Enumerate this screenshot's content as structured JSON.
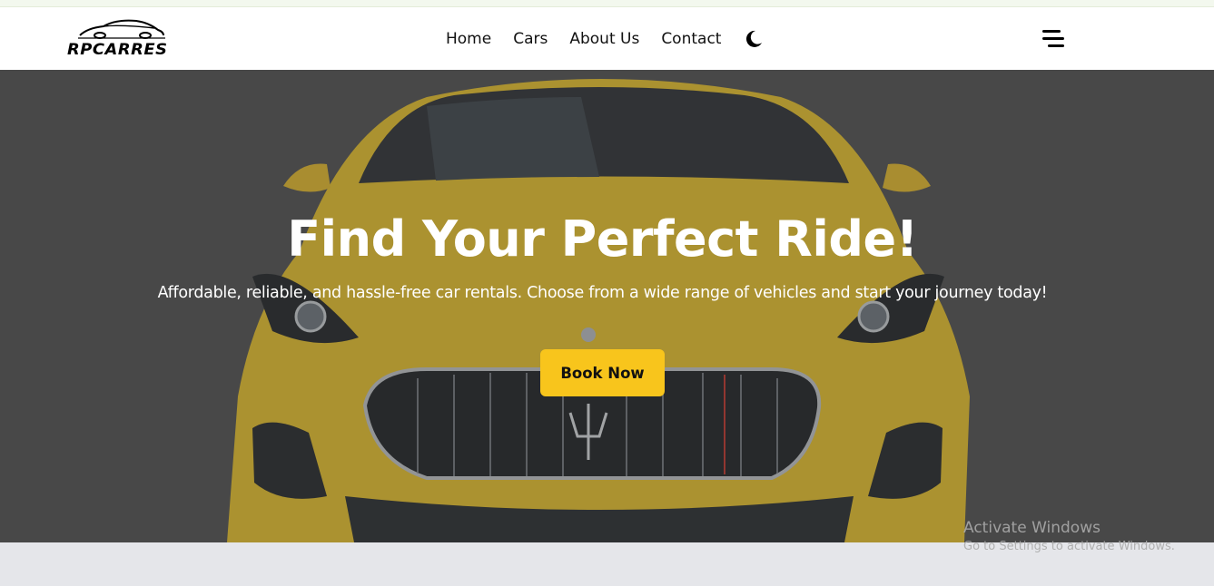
{
  "brand": {
    "name": "RPCARRES"
  },
  "nav": {
    "links": [
      "Home",
      "Cars",
      "About Us",
      "Contact"
    ],
    "theme_toggle_icon": "moon-icon",
    "menu_icon": "hamburger-menu-icon"
  },
  "hero": {
    "title": "Find Your Perfect Ride!",
    "subtitle": "Affordable, reliable, and hassle-free car rentals. Choose from a wide range of vehicles and start your journey today!",
    "cta": "Book Now"
  },
  "colors": {
    "accent": "#f8c51c",
    "car_body": "#e7c02a",
    "nav_bg": "#ffffff"
  },
  "os_watermark": {
    "title": "Activate Windows",
    "subtitle": "Go to Settings to activate Windows."
  }
}
